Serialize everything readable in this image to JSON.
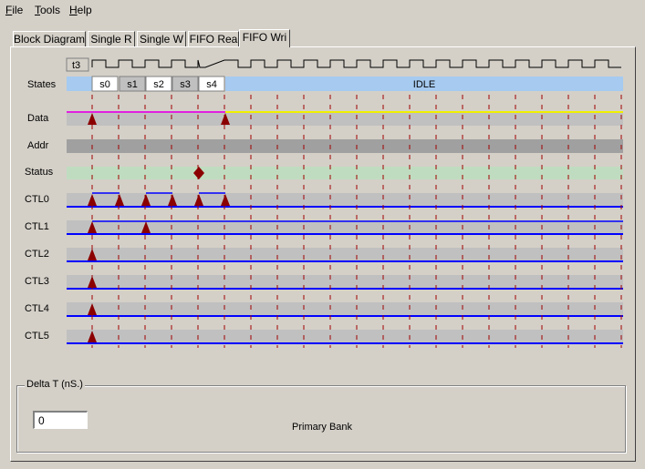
{
  "menu": [
    {
      "label": "File",
      "mnemonic": "F",
      "rest": "ile"
    },
    {
      "label": "Tools",
      "mnemonic": "T",
      "rest": "ools"
    },
    {
      "label": "Help",
      "mnemonic": "H",
      "rest": "elp"
    }
  ],
  "tabs": [
    {
      "label": "Block Diagram"
    },
    {
      "label": "Single R"
    },
    {
      "label": "Single W"
    },
    {
      "label": "FIFO Rea"
    },
    {
      "label": "FIFO Wri"
    }
  ],
  "active_tab": "FIFO Wri",
  "timing": {
    "clock_label": "t3",
    "states_label": "States",
    "states": [
      "s0",
      "s1",
      "s2",
      "s3",
      "s4"
    ],
    "idle_label": "IDLE",
    "signals": [
      "Data",
      "Addr",
      "Status",
      "CTL0",
      "CTL1",
      "CTL2",
      "CTL3",
      "CTL4",
      "CTL5"
    ],
    "colors": {
      "data_before": "#e020e0",
      "data_after": "#f0f000",
      "low_line": "#0000ff",
      "marker": "#8b0000",
      "status_bar": "#c0dcc0",
      "idle_bar": "#a6caf0",
      "addr_bar": "#a0a0a0",
      "bus_bar": "#c0c0c0",
      "gridline": "#a00000"
    }
  },
  "delta_t": {
    "label": "Delta T (nS.)",
    "value": "0"
  },
  "bank_label": "Primary Bank"
}
